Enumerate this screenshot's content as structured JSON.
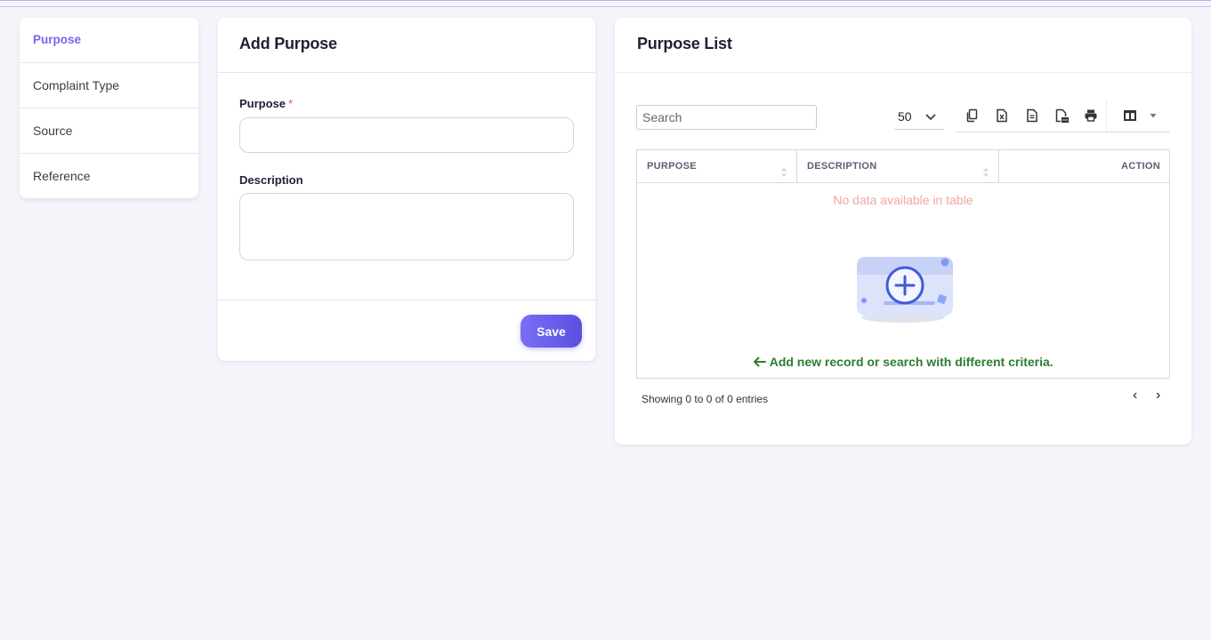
{
  "sidebar": {
    "items": [
      {
        "label": "Purpose",
        "active": true
      },
      {
        "label": "Complaint Type",
        "active": false
      },
      {
        "label": "Source",
        "active": false
      },
      {
        "label": "Reference",
        "active": false
      }
    ]
  },
  "add_form": {
    "title": "Add Purpose",
    "purpose_label": "Purpose",
    "required_mark": "*",
    "purpose_value": "",
    "description_label": "Description",
    "description_value": "",
    "save_label": "Save"
  },
  "list": {
    "title": "Purpose List",
    "search_placeholder": "Search",
    "page_length": "50",
    "toolbar_icons": [
      "copy-icon",
      "excel-icon",
      "csv-icon",
      "pdf-icon",
      "print-icon",
      "column-visibility-icon"
    ],
    "columns": [
      "PURPOSE",
      "DESCRIPTION",
      "ACTION"
    ],
    "rows": [],
    "empty_message": "No data available in table",
    "hint": "Add new record or search with different criteria.",
    "info": "Showing 0 to 0 of 0 entries",
    "prev": "‹",
    "next": "›"
  },
  "colors": {
    "accent": "#7367f0",
    "save_gradient_start": "#7b6ef5",
    "save_gradient_end": "#5b4fe0",
    "empty_text": "#f0a5a5",
    "hint_text": "#2e7d32",
    "background": "#f4f5fa"
  }
}
